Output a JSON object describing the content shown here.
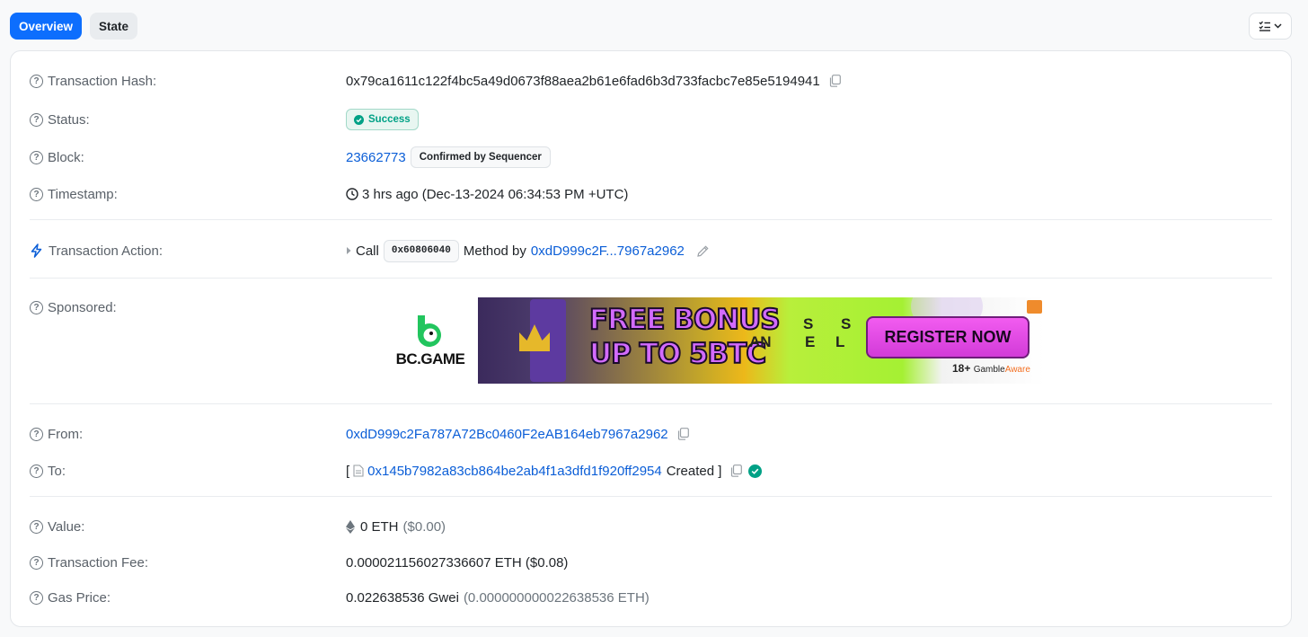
{
  "tabs": {
    "overview": "Overview",
    "state": "State"
  },
  "colors": {
    "accent": "#0d6efd",
    "link": "#0b5ed7",
    "success": "#00a186"
  },
  "icons": {
    "view_menu": "list-check-icon",
    "help": "question-circle-icon",
    "copy": "copy-icon",
    "clock": "clock-icon",
    "bolt": "bolt-icon",
    "edit": "pencil-icon",
    "eth": "ethereum-icon",
    "contract": "file-contract-icon",
    "verified": "check-circle-icon"
  },
  "rows": {
    "tx_hash": {
      "label": "Transaction Hash:",
      "value": "0x79ca1611c122f4bc5a49d0673f88aea2b61e6fad6b3d733facbc7e85e5194941"
    },
    "status": {
      "label": "Status:",
      "value": "Success"
    },
    "block": {
      "label": "Block:",
      "value": "23662773",
      "badge": "Confirmed by Sequencer"
    },
    "timestamp": {
      "label": "Timestamp:",
      "value": "3 hrs ago (Dec-13-2024 06:34:53 PM +UTC)"
    },
    "action": {
      "label": "Transaction Action:",
      "call": "Call",
      "method": "0x60806040",
      "method_by": "Method by",
      "address": "0xdD999c2F...7967a2962"
    },
    "sponsored": {
      "label": "Sponsored:"
    },
    "from": {
      "label": "From:",
      "value": "0xdD999c2Fa787A72Bc0460F2eAB164eb7967a2962"
    },
    "to": {
      "label": "To:",
      "open_bracket": "[",
      "value": "0x145b7982a83cb864be2ab4f1a3dfd1f920ff2954",
      "created": "Created ]"
    },
    "value": {
      "label": "Value:",
      "amount": "0 ETH",
      "usd": "($0.00)"
    },
    "fee": {
      "label": "Transaction Fee:",
      "value": "0.000021156027336607 ETH ($0.08)"
    },
    "gas": {
      "label": "Gas Price:",
      "value": "0.022638536 Gwei",
      "eth": "(0.000000000022638536 ETH)"
    }
  },
  "ad": {
    "brand": "BC.GAME",
    "headline_1": "FREE BONUS",
    "headline_2": "UP TO 5BTC",
    "c1": "AN",
    "c2": "S",
    "c3": "E",
    "c4": "S",
    "c5": "L",
    "cta": "REGISTER NOW",
    "age": "18+",
    "gamble": "Gamble",
    "aware": "Aware"
  }
}
